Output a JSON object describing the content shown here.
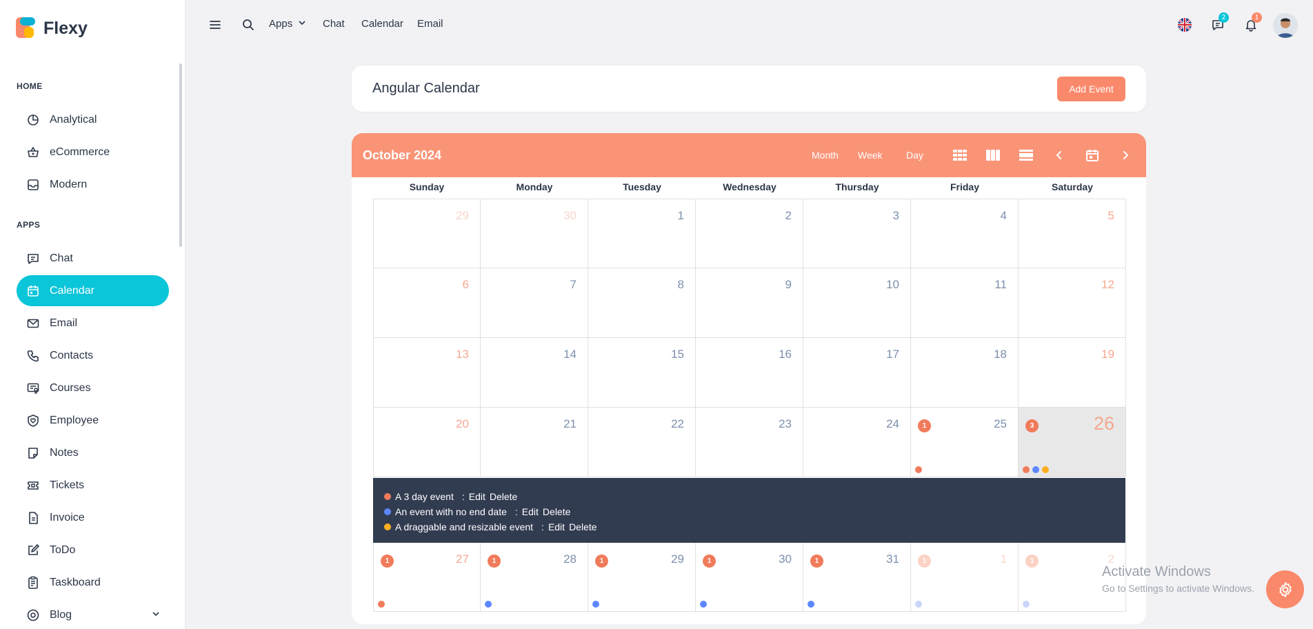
{
  "brand": {
    "name": "Flexy"
  },
  "sidebar": {
    "sections": [
      {
        "caption": "HOME",
        "items": [
          {
            "label": "Analytical",
            "icon": "pie-chart-icon"
          },
          {
            "label": "eCommerce",
            "icon": "basket-icon"
          },
          {
            "label": "Modern",
            "icon": "inbox-icon"
          }
        ]
      },
      {
        "caption": "APPS",
        "items": [
          {
            "label": "Chat",
            "icon": "message-icon"
          },
          {
            "label": "Calendar",
            "icon": "calendar-icon",
            "active": true
          },
          {
            "label": "Email",
            "icon": "mail-icon"
          },
          {
            "label": "Contacts",
            "icon": "phone-icon"
          },
          {
            "label": "Courses",
            "icon": "certificate-icon"
          },
          {
            "label": "Employee",
            "icon": "shield-heart-icon"
          },
          {
            "label": "Notes",
            "icon": "note-icon"
          },
          {
            "label": "Tickets",
            "icon": "ticket-icon"
          },
          {
            "label": "Invoice",
            "icon": "file-text-icon"
          },
          {
            "label": "ToDo",
            "icon": "edit-icon"
          },
          {
            "label": "Taskboard",
            "icon": "clipboard-icon"
          },
          {
            "label": "Blog",
            "icon": "globe-icon",
            "expandable": true
          }
        ]
      }
    ]
  },
  "topbar": {
    "links": [
      "Apps",
      "Chat",
      "Calendar",
      "Email"
    ],
    "messages_badge": "2",
    "notifications_badge": "1"
  },
  "page": {
    "title": "Angular Calendar",
    "add_event_label": "Add Event"
  },
  "calendar": {
    "month_label": "October 2024",
    "views": [
      "Month",
      "Week",
      "Day"
    ],
    "weekdays": [
      "Sunday",
      "Monday",
      "Tuesday",
      "Wednesday",
      "Thursday",
      "Friday",
      "Saturday"
    ],
    "weeks": [
      [
        {
          "d": "29",
          "muted": true
        },
        {
          "d": "30",
          "muted": true
        },
        {
          "d": "1"
        },
        {
          "d": "2"
        },
        {
          "d": "3"
        },
        {
          "d": "4"
        },
        {
          "d": "5",
          "weekend": true
        }
      ],
      [
        {
          "d": "6",
          "weekend": true
        },
        {
          "d": "7"
        },
        {
          "d": "8"
        },
        {
          "d": "9"
        },
        {
          "d": "10"
        },
        {
          "d": "11"
        },
        {
          "d": "12",
          "weekend": true
        }
      ],
      [
        {
          "d": "13",
          "weekend": true
        },
        {
          "d": "14"
        },
        {
          "d": "15"
        },
        {
          "d": "16"
        },
        {
          "d": "17"
        },
        {
          "d": "18"
        },
        {
          "d": "19",
          "weekend": true
        }
      ],
      [
        {
          "d": "20",
          "weekend": true
        },
        {
          "d": "21"
        },
        {
          "d": "22"
        },
        {
          "d": "23"
        },
        {
          "d": "24"
        },
        {
          "d": "25",
          "count": "1",
          "dots": [
            "#f07b5b"
          ]
        },
        {
          "d": "26",
          "today": true,
          "count": "3",
          "dots": [
            "#f07b5b",
            "#5d87ff",
            "#ffae1f"
          ]
        }
      ],
      [
        {
          "d": "27",
          "weekend": true,
          "count": "1",
          "dots": [
            "#f07b5b"
          ]
        },
        {
          "d": "28",
          "count": "1",
          "dots": [
            "#5d87ff"
          ]
        },
        {
          "d": "29",
          "count": "1",
          "dots": [
            "#5d87ff"
          ]
        },
        {
          "d": "30",
          "count": "1",
          "dots": [
            "#5d87ff"
          ]
        },
        {
          "d": "31",
          "count": "1",
          "dots": [
            "#5d87ff"
          ]
        },
        {
          "d": "1",
          "muted": true,
          "count": "1",
          "faded": true,
          "dots": [
            "#c9d5fb"
          ]
        },
        {
          "d": "2",
          "muted": true,
          "count": "1",
          "faded": true,
          "dots": [
            "#c9d5fb"
          ]
        }
      ]
    ],
    "open_day_events": [
      {
        "title": "A 3 day event",
        "color": "#f07b5b"
      },
      {
        "title": "An event with no end date",
        "color": "#5d87ff"
      },
      {
        "title": "A draggable and resizable event",
        "color": "#ffae1f"
      }
    ],
    "edit_label": "Edit",
    "delete_label": "Delete"
  },
  "watermark": {
    "line1": "Activate Windows",
    "line2": "Go to Settings to activate Windows."
  },
  "colors": {
    "primary": "#0bc5d9",
    "secondary": "#fa896b",
    "dark_panel": "#323c51"
  }
}
